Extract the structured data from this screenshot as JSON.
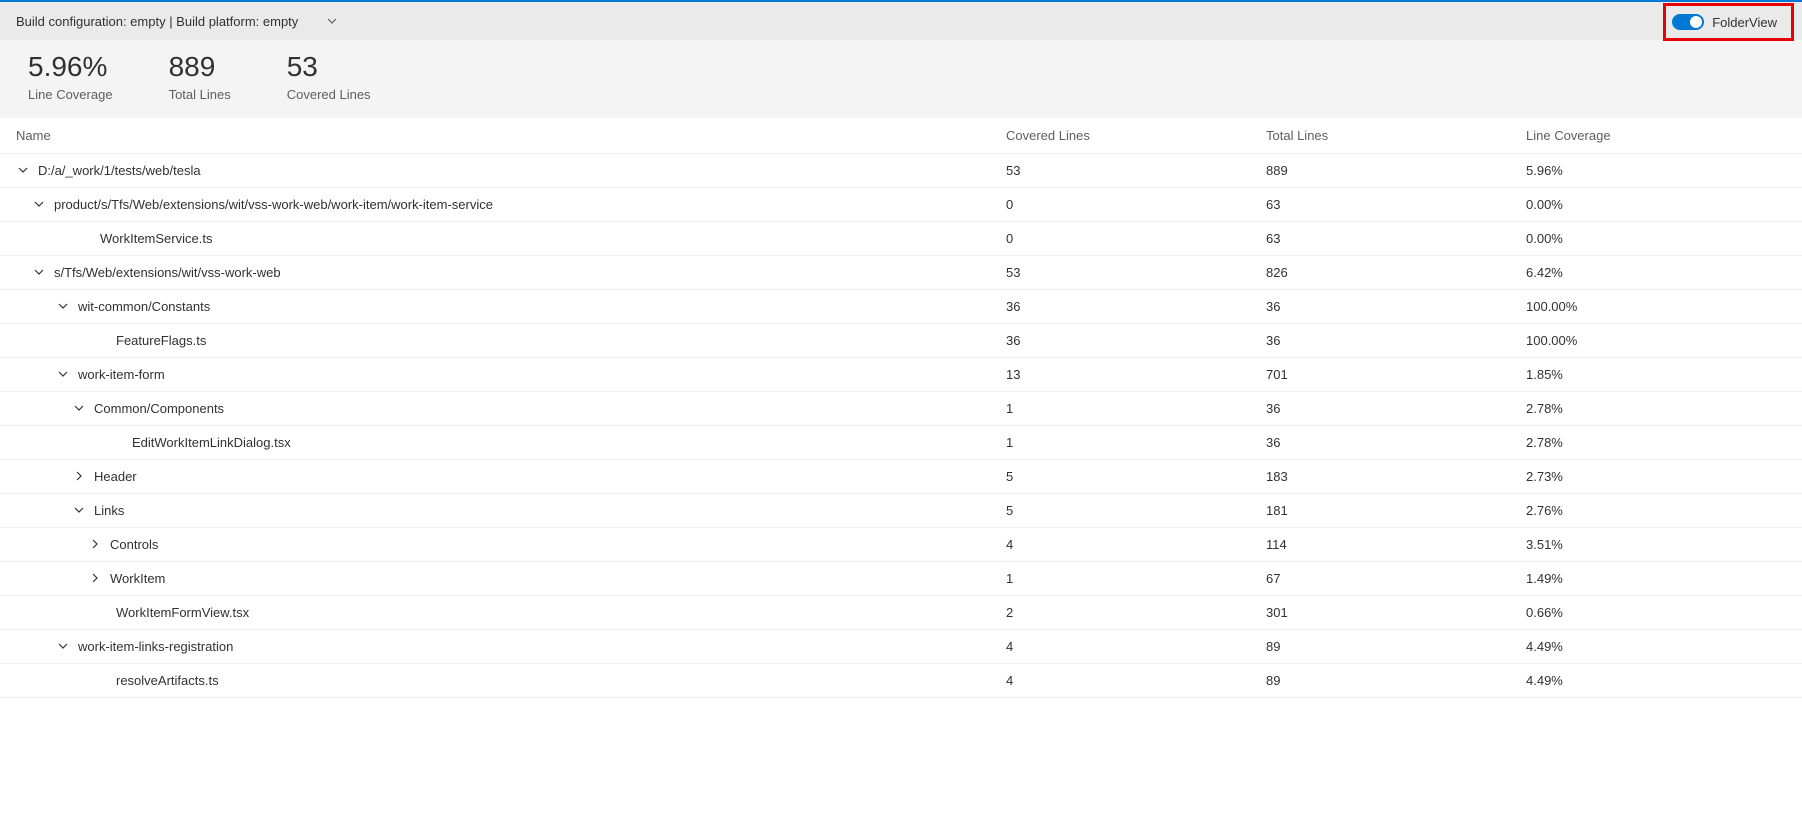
{
  "topbar": {
    "breadcrumb": "Build configuration: empty | Build platform: empty",
    "folderview_label": "FolderView"
  },
  "summary": {
    "line_coverage": {
      "value": "5.96%",
      "label": "Line Coverage"
    },
    "total_lines": {
      "value": "889",
      "label": "Total Lines"
    },
    "covered_lines": {
      "value": "53",
      "label": "Covered Lines"
    }
  },
  "columns": {
    "name": "Name",
    "covered": "Covered Lines",
    "total": "Total Lines",
    "lc": "Line Coverage"
  },
  "rows": [
    {
      "indent": 0,
      "arrow": "down",
      "name": "D:/a/_work/1/tests/web/tesla",
      "covered": "53",
      "total": "889",
      "lc": "5.96%"
    },
    {
      "indent": 1,
      "arrow": "down",
      "name": "product/s/Tfs/Web/extensions/wit/vss-work-web/work-item/work-item-service",
      "covered": "0",
      "total": "63",
      "lc": "0.00%"
    },
    {
      "indent": 2,
      "arrow": "none",
      "name": "WorkItemService.ts",
      "covered": "0",
      "total": "63",
      "lc": "0.00%"
    },
    {
      "indent": 1,
      "arrow": "down",
      "name": "s/Tfs/Web/extensions/wit/vss-work-web",
      "covered": "53",
      "total": "826",
      "lc": "6.42%"
    },
    {
      "indent": 2,
      "arrow": "down",
      "name": "wit-common/Constants",
      "covered": "36",
      "total": "36",
      "lc": "100.00%"
    },
    {
      "indent": 3,
      "arrow": "none",
      "name": "FeatureFlags.ts",
      "covered": "36",
      "total": "36",
      "lc": "100.00%"
    },
    {
      "indent": 2,
      "arrow": "down",
      "name": "work-item-form",
      "covered": "13",
      "total": "701",
      "lc": "1.85%"
    },
    {
      "indent": 3,
      "arrow": "down",
      "name": "Common/Components",
      "covered": "1",
      "total": "36",
      "lc": "2.78%"
    },
    {
      "indent": 4,
      "arrow": "none",
      "name": "EditWorkItemLinkDialog.tsx",
      "covered": "1",
      "total": "36",
      "lc": "2.78%"
    },
    {
      "indent": 3,
      "arrow": "right",
      "name": "Header",
      "covered": "5",
      "total": "183",
      "lc": "2.73%"
    },
    {
      "indent": 3,
      "arrow": "down",
      "name": "Links",
      "covered": "5",
      "total": "181",
      "lc": "2.76%"
    },
    {
      "indent": 4,
      "arrow": "right",
      "name": "Controls",
      "covered": "4",
      "total": "114",
      "lc": "3.51%"
    },
    {
      "indent": 4,
      "arrow": "right",
      "name": "WorkItem",
      "covered": "1",
      "total": "67",
      "lc": "1.49%"
    },
    {
      "indent": 3,
      "arrow": "none",
      "name": "WorkItemFormView.tsx",
      "covered": "2",
      "total": "301",
      "lc": "0.66%"
    },
    {
      "indent": 2,
      "arrow": "down",
      "name": "work-item-links-registration",
      "covered": "4",
      "total": "89",
      "lc": "4.49%"
    },
    {
      "indent": 3,
      "arrow": "none",
      "name": "resolveArtifacts.ts",
      "covered": "4",
      "total": "89",
      "lc": "4.49%"
    }
  ]
}
